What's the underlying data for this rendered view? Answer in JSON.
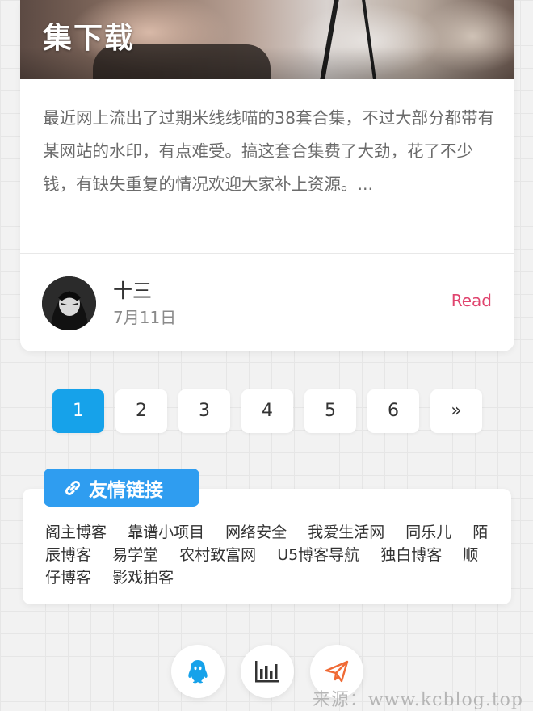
{
  "post": {
    "title": "集下载",
    "excerpt": "最近网上流出了过期米线线喵的38套合集，不过大部分都带有某网站的水印，有点难受。搞这套合集费了大劲，花了不少钱，有缺失重复的情况欢迎大家补上资源。...",
    "author": "十三",
    "date": "7月11日",
    "read_label": "Read",
    "read_color": "#e0446e"
  },
  "pagination": {
    "pages": [
      "1",
      "2",
      "3",
      "4",
      "5",
      "6",
      "»"
    ],
    "current": "1",
    "active_color": "#16a2ea"
  },
  "friend_links": {
    "title": "友情链接",
    "icon": "link-icon",
    "badge_color": "#2f9df0",
    "items": [
      "阁主博客",
      "靠谱小项目",
      "网络安全",
      "我爱生活网",
      "同乐儿",
      "陌辰博客",
      "易学堂",
      "农村致富网",
      "U5博客导航",
      "独白博客",
      "顺仔博客",
      "影戏拍客"
    ]
  },
  "bottom_actions": [
    {
      "icon": "qq-icon",
      "color": "#16a2ea"
    },
    {
      "icon": "bar-chart-icon",
      "color": "#333333"
    },
    {
      "icon": "paper-plane-icon",
      "color": "#f06a35"
    }
  ],
  "watermark": "来源：www.kcblog.top"
}
